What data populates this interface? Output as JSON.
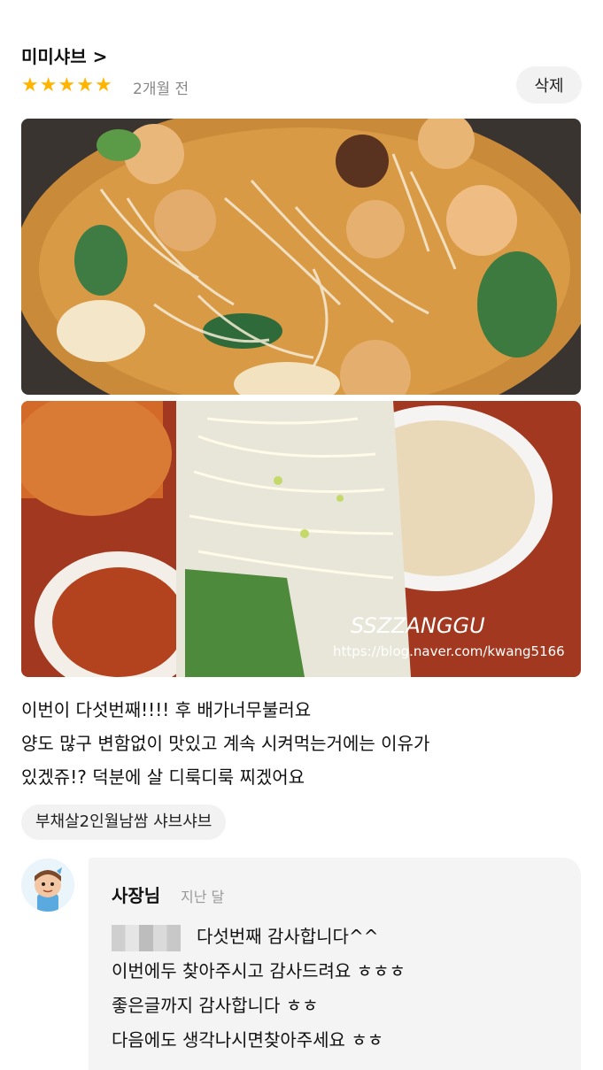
{
  "store": {
    "name": "미미샤브 >"
  },
  "rating": {
    "stars": 5,
    "max": 5,
    "time_ago": "2개월 전"
  },
  "actions": {
    "delete_label": "삭제"
  },
  "photos": [
    {
      "watermark": ""
    },
    {
      "watermark_title": "SSZZANGGU",
      "watermark_url": "https://blog.naver.com/kwang5166"
    }
  ],
  "review": {
    "lines": [
      "이번이 다섯번째!!!! 후 배가너무불러요",
      "양도 많구 변함없이 맛있고 계속 시켜먹는거에는 이유가",
      "있겠쥬!? 덕분에 살 디룩디룩 찌겠어요"
    ],
    "menu_tag": "부채살2인월남쌈 샤브샤브"
  },
  "owner_reply": {
    "author": "사장님",
    "time_ago": "지난 달",
    "line1": "다섯번째 감사합니다^^",
    "line2": "이번에두 찾아주시고 감사드려요 ㅎㅎㅎ",
    "line3": "좋은글까지 감사합니다 ㅎㅎ",
    "line4": "다음에도 생각나시면찾아주세요 ㅎㅎ"
  },
  "colors": {
    "star": "#ffb400",
    "chip_bg": "#f2f2f2",
    "reply_bg": "#f4f4f4",
    "muted_text": "#888888"
  }
}
